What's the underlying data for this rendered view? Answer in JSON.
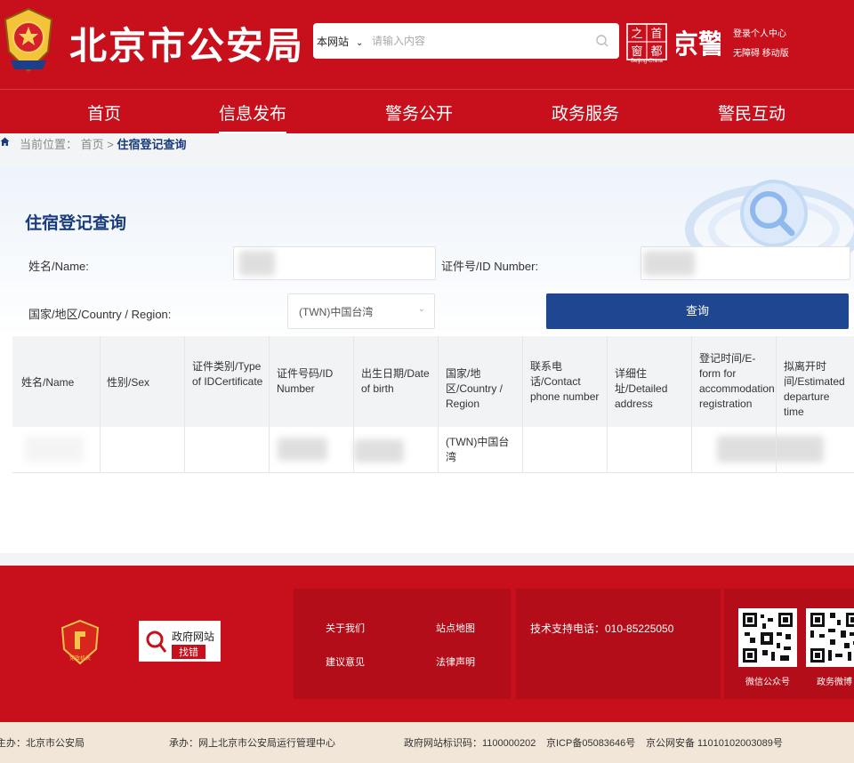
{
  "header": {
    "site_title": "北京市公安局",
    "search": {
      "scope": "本网站",
      "placeholder": "请输入内容"
    },
    "capital_logo": {
      "chars": [
        "之",
        "首",
        "窗",
        "都"
      ],
      "caption": "Beijing-China"
    },
    "jing_logo": "京警",
    "links": {
      "login": "登录个人中心",
      "accessible": "无障碍",
      "mobile": "移动版"
    }
  },
  "nav": [
    "首页",
    "信息发布",
    "警务公开",
    "政务服务",
    "警民互动"
  ],
  "nav_active_index": 1,
  "breadcrumb": {
    "prefix": "当前位置：",
    "home": "首页",
    "sep": ">",
    "current": "住宿登记查询"
  },
  "form": {
    "title": "住宿登记查询",
    "name_label": "姓名/Name:",
    "id_label": "证件号/ID Number:",
    "country_label": "国家/地区/Country / Region:",
    "country_value": "(TWN)中国台湾",
    "query_button": "查询"
  },
  "table": {
    "headers": [
      "姓名/Name",
      "性别/Sex",
      "证件类别/Type of IDCertificate",
      "证件号码/ID Number",
      "出生日期/Date of birth",
      "国家/地区/Country / Region",
      "联系电话/Contact phone number",
      "详细住址/Detailed address",
      "登记时间/E-form for accommodation registration",
      "拟离开时间/Estimated departure time"
    ],
    "rows": [
      {
        "country": "(TWN)中国台湾"
      }
    ]
  },
  "footer": {
    "party_badge": "党政机关",
    "gov_find": {
      "line1": "政府网站",
      "line2": "找错"
    },
    "links": [
      "关于我们",
      "站点地图",
      "建议意见",
      "法律声明"
    ],
    "support": "技术支持电话：010-85225050",
    "qr_captions": [
      "微信公众号",
      "政务微博"
    ],
    "filing": [
      "主办：北京市公安局",
      "承办：网上北京市公安局运行管理中心",
      "政府网站标识码：1100000202",
      "京ICP备05083646号",
      "京公网安备 11010102003089号"
    ]
  },
  "colors": {
    "brand_red": "#c8101c",
    "deep_blue": "#1f4690",
    "title_blue": "#1a3c7c"
  }
}
